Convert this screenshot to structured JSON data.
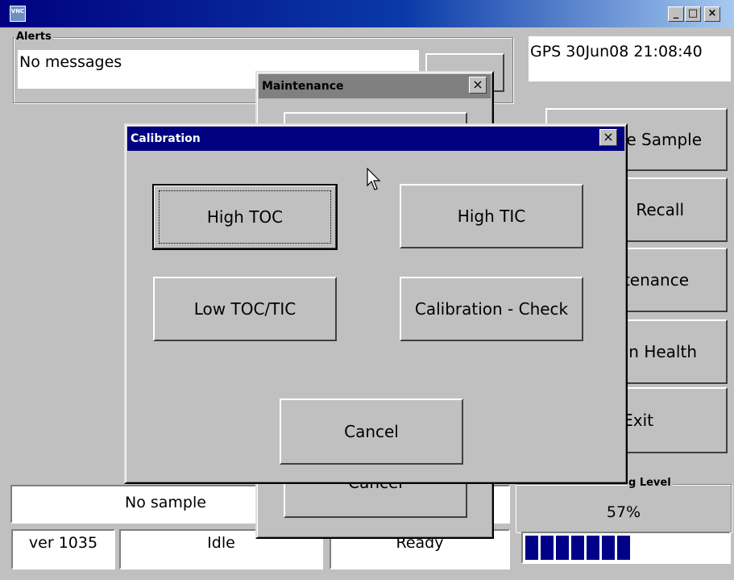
{
  "window": {
    "icon_label": "VNC",
    "controls": {
      "minimize": "_",
      "maximize": "□",
      "close": "×"
    }
  },
  "alerts": {
    "legend": "Alerts",
    "message": "No messages",
    "button_label": ""
  },
  "gps": {
    "text": "GPS 30Jun08 21:08:40"
  },
  "right_buttons": [
    "e Sample",
    "Recall",
    "tenance",
    "n Health",
    "Exit"
  ],
  "waste": {
    "legend": "Waste Bag Level",
    "legend_visible": "g Level",
    "value": "57%",
    "fraction": 0.57,
    "segments": 7
  },
  "status": {
    "sample": "No sample",
    "version": "ver 1035",
    "state": "Idle",
    "ready": "Ready"
  },
  "maintenance": {
    "title": "Maintenance",
    "close": "×",
    "hidden_cancel": "Cancel"
  },
  "calibration": {
    "title": "Calibration",
    "close": "×",
    "buttons": {
      "high_toc": "High TOC",
      "high_tic": "High TIC",
      "low_toc_tic": "Low TOC/TIC",
      "cal_check": "Calibration - Check",
      "cancel": "Cancel"
    }
  },
  "colors": {
    "active_title": "#000080",
    "inactive_title": "#808080",
    "progress": "#000088",
    "face": "#c0c0c0"
  }
}
